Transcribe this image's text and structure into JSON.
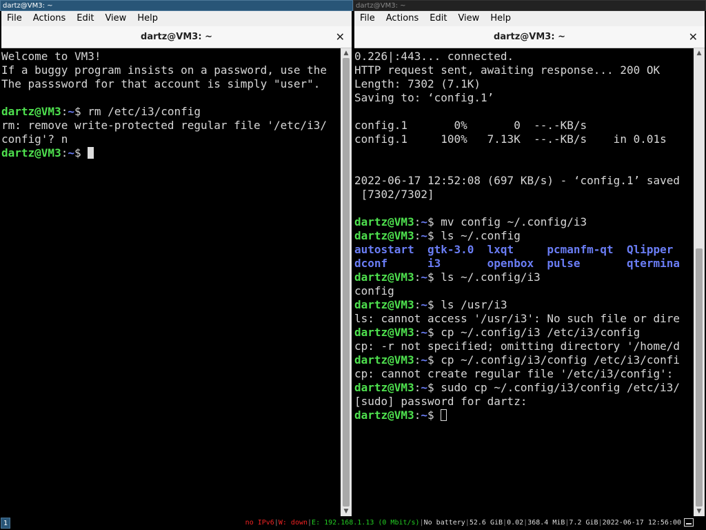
{
  "left": {
    "i3_title": "dartz@VM3: ~",
    "menu": [
      "File",
      "Actions",
      "Edit",
      "View",
      "Help"
    ],
    "tab_title": "dartz@VM3: ~",
    "close": "✕",
    "lines": [
      [
        {
          "t": "Welcome to VM3!"
        }
      ],
      [
        {
          "t": "If a buggy program insists on a password, use the"
        }
      ],
      [
        {
          "t": "The passsword for that account is simply \"user\"."
        }
      ],
      [],
      [
        {
          "t": "dartz@VM3",
          "c": "user"
        },
        {
          "t": ":"
        },
        {
          "t": "~",
          "c": "path"
        },
        {
          "t": "$ rm /etc/i3/config"
        }
      ],
      [
        {
          "t": "rm: remove write-protected regular file '/etc/i3/"
        }
      ],
      [
        {
          "t": "config'? n"
        }
      ],
      [
        {
          "t": "dartz@VM3",
          "c": "user"
        },
        {
          "t": ":"
        },
        {
          "t": "~",
          "c": "path"
        },
        {
          "t": "$ "
        },
        {
          "cursor": "solid"
        }
      ]
    ]
  },
  "right": {
    "i3_title": "dartz@VM3: ~",
    "menu": [
      "File",
      "Actions",
      "Edit",
      "View",
      "Help"
    ],
    "tab_title": "dartz@VM3: ~",
    "close": "✕",
    "lines": [
      [
        {
          "t": "0.226|:443... connected."
        }
      ],
      [
        {
          "t": "HTTP request sent, awaiting response... 200 OK"
        }
      ],
      [
        {
          "t": "Length: 7302 (7.1K)"
        }
      ],
      [
        {
          "t": "Saving to: ‘config.1’"
        }
      ],
      [],
      [
        {
          "t": "config.1       0%       0  --.-KB/s"
        }
      ],
      [
        {
          "t": "config.1     100%   7.13K  --.-KB/s    in 0.01s"
        }
      ],
      [],
      [],
      [
        {
          "t": "2022-06-17 12:52:08 (697 KB/s) - ‘config.1’ saved"
        }
      ],
      [
        {
          "t": " [7302/7302]"
        }
      ],
      [],
      [
        {
          "t": "dartz@VM3",
          "c": "user"
        },
        {
          "t": ":"
        },
        {
          "t": "~",
          "c": "path"
        },
        {
          "t": "$ mv config ~/.config/i3"
        }
      ],
      [
        {
          "t": "dartz@VM3",
          "c": "user"
        },
        {
          "t": ":"
        },
        {
          "t": "~",
          "c": "path"
        },
        {
          "t": "$ ls ~/.config"
        }
      ],
      [
        {
          "t": "autostart  gtk-3.0  lxqt     pcmanfm-qt  Qlipper",
          "c": "dir"
        }
      ],
      [
        {
          "t": "dconf      i3       openbox  pulse       qtermina",
          "c": "dir"
        }
      ],
      [
        {
          "t": "dartz@VM3",
          "c": "user"
        },
        {
          "t": ":"
        },
        {
          "t": "~",
          "c": "path"
        },
        {
          "t": "$ ls ~/.config/i3"
        }
      ],
      [
        {
          "t": "config"
        }
      ],
      [
        {
          "t": "dartz@VM3",
          "c": "user"
        },
        {
          "t": ":"
        },
        {
          "t": "~",
          "c": "path"
        },
        {
          "t": "$ ls /usr/i3"
        }
      ],
      [
        {
          "t": "ls: cannot access '/usr/i3': No such file or dire"
        }
      ],
      [
        {
          "t": "dartz@VM3",
          "c": "user"
        },
        {
          "t": ":"
        },
        {
          "t": "~",
          "c": "path"
        },
        {
          "t": "$ cp ~/.config/i3 /etc/i3/config"
        }
      ],
      [
        {
          "t": "cp: -r not specified; omitting directory '/home/d"
        }
      ],
      [
        {
          "t": "dartz@VM3",
          "c": "user"
        },
        {
          "t": ":"
        },
        {
          "t": "~",
          "c": "path"
        },
        {
          "t": "$ cp ~/.config/i3/config /etc/i3/confi"
        }
      ],
      [
        {
          "t": "cp: cannot create regular file '/etc/i3/config':"
        }
      ],
      [
        {
          "t": "dartz@VM3",
          "c": "user"
        },
        {
          "t": ":"
        },
        {
          "t": "~",
          "c": "path"
        },
        {
          "t": "$ sudo cp ~/.config/i3/config /etc/i3/"
        }
      ],
      [
        {
          "t": "[sudo] password for dartz:"
        }
      ],
      [
        {
          "t": "dartz@VM3",
          "c": "user"
        },
        {
          "t": ":"
        },
        {
          "t": "~",
          "c": "path"
        },
        {
          "t": "$ "
        },
        {
          "cursor": "hollow"
        }
      ]
    ]
  },
  "statusbar": {
    "workspace": "1",
    "items": [
      {
        "t": "no IPv6",
        "c": "red"
      },
      {
        "t": "W: down",
        "c": "red"
      },
      {
        "t": "E: 192.168.1.13 (0 Mbit/s)",
        "c": "green"
      },
      {
        "t": "No battery"
      },
      {
        "t": "52.6 GiB"
      },
      {
        "t": "0.02"
      },
      {
        "t": "368.4 MiB"
      },
      {
        "t": "7.2 GiB"
      },
      {
        "t": "2022-06-17 12:56:00"
      }
    ],
    "tray_icon": "window-icon"
  },
  "colors": {
    "prompt_user": "#4ee04e",
    "prompt_path": "#6a7df5",
    "directory": "#6a7df5",
    "focused_title_bg": "#285577",
    "status_red": "#ee2222",
    "status_green": "#22cc22"
  }
}
